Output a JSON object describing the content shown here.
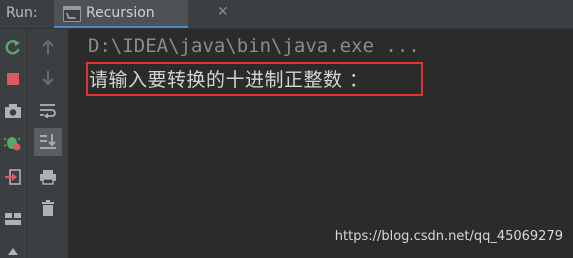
{
  "runbar": {
    "label": "Run:",
    "tab": {
      "title": "Recursion",
      "close": "✕"
    }
  },
  "toolbar_primary": [
    {
      "name": "rerun-icon",
      "color": "#59a869"
    },
    {
      "name": "stop-icon",
      "color": "#db5860"
    },
    {
      "name": "camera-icon",
      "color": "#afb1b3"
    },
    {
      "name": "debug-settings-icon",
      "color": "#59a869"
    },
    {
      "name": "restore-layout-icon",
      "color": "#db5860"
    },
    {
      "name": "layout-icon",
      "color": "#afb1b3"
    }
  ],
  "toolbar_secondary": [
    {
      "name": "up-arrow-icon",
      "color": "#6a6d70"
    },
    {
      "name": "down-arrow-icon",
      "color": "#6a6d70"
    },
    {
      "name": "soft-wrap-icon",
      "color": "#afb1b3"
    },
    {
      "name": "scroll-to-end-icon",
      "color": "#afb1b3"
    },
    {
      "name": "print-icon",
      "color": "#afb1b3"
    },
    {
      "name": "trash-icon",
      "color": "#afb1b3"
    }
  ],
  "console": {
    "command": "D:\\IDEA\\java\\bin\\java.exe ...",
    "prompt": "请输入要转换的十进制正整数 ："
  },
  "highlight_color": "#e0342f",
  "watermark": "https://blog.csdn.net/qq_45069279"
}
